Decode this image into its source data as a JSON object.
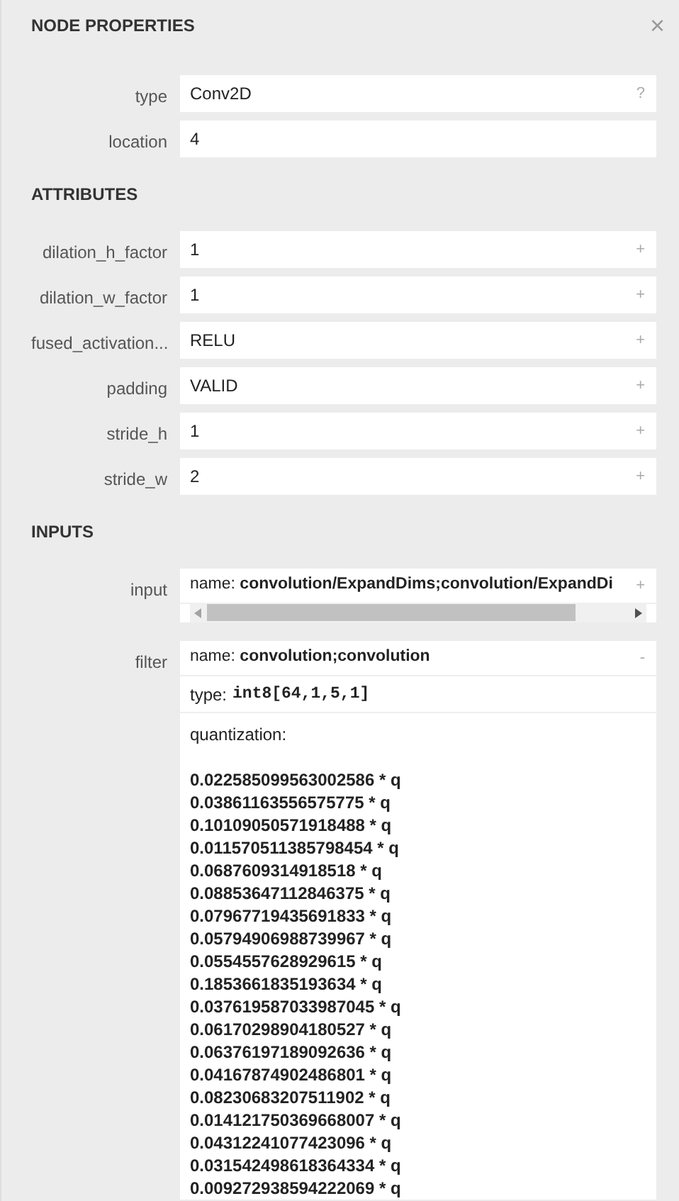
{
  "title": "NODE PROPERTIES",
  "close": "×",
  "properties": [
    {
      "label": "type",
      "value": "Conv2D",
      "button": "?"
    },
    {
      "label": "location",
      "value": "4"
    }
  ],
  "sections": [
    {
      "title": "ATTRIBUTES",
      "items": [
        {
          "label": "dilation_h_factor",
          "value": "1",
          "button": "+"
        },
        {
          "label": "dilation_w_factor",
          "value": "1",
          "button": "+"
        },
        {
          "label": "fused_activation...",
          "value": "RELU",
          "button": "+"
        },
        {
          "label": "padding",
          "value": "VALID",
          "button": "+"
        },
        {
          "label": "stride_h",
          "value": "1",
          "button": "+"
        },
        {
          "label": "stride_w",
          "value": "2",
          "button": "+"
        }
      ]
    },
    {
      "title": "INPUTS",
      "inputs": [
        {
          "label": "input",
          "name": "name: **convolution/ExpandDims;convolution/ExpandDi**",
          "button": "+",
          "expanded": false,
          "scrollbar": true
        },
        {
          "label": "filter",
          "name": "name: **convolution;convolution**",
          "button": "-",
          "expanded": true,
          "type_label": "type:",
          "type_value": "int8[64,1,5,1]",
          "quant_label": "quantization:",
          "quant_values": [
            "0.022585099563002586 * q",
            "0.03861163556575775 * q",
            "0.10109050571918488 * q",
            "0.011570511385798454 * q",
            "0.0687609314918518 * q",
            "0.08853647112846375 * q",
            "0.07967719435691833 * q",
            "0.05794906988739967 * q",
            "0.0554557628929615 * q",
            "0.1853661835193634 * q",
            "0.037619587033987045 * q",
            "0.06170298904180527 * q",
            "0.06376197189092636 * q",
            "0.04167874902486801 * q",
            "0.08230683207511902 * q",
            "0.014121750369668007 * q",
            "0.04312241077423096 * q",
            "0.031542498618364334 * q",
            "0.009272938594222069 * q"
          ]
        }
      ]
    }
  ]
}
